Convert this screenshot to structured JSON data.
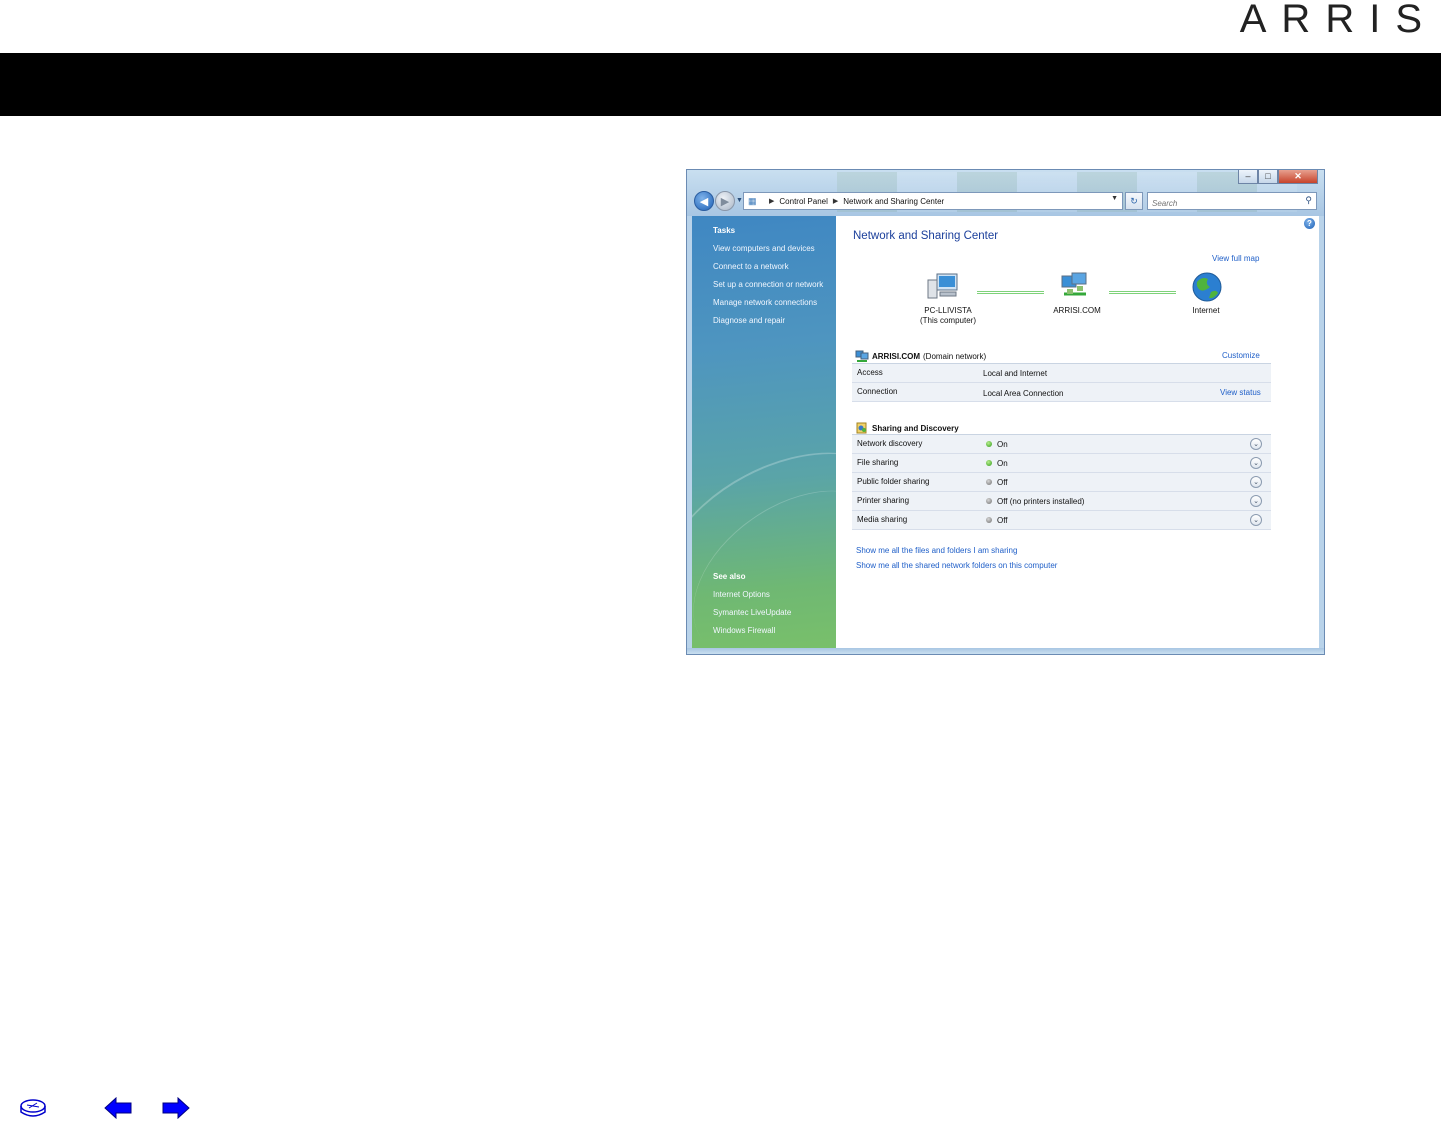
{
  "brand": {
    "logo_text": "ARRIS"
  },
  "window": {
    "address": {
      "crumb_1": "Control Panel",
      "crumb_2": "Network and Sharing Center"
    },
    "search_placeholder": "Search",
    "sidebar": {
      "tasks_heading": "Tasks",
      "tasks": [
        "View computers and devices",
        "Connect to a network",
        "Set up a connection or network",
        "Manage network connections",
        "Diagnose and repair"
      ],
      "see_also_heading": "See also",
      "see_also": [
        "Internet Options",
        "Symantec LiveUpdate",
        "Windows Firewall"
      ]
    },
    "main": {
      "title": "Network and Sharing Center",
      "view_full_map": "View full map",
      "map": {
        "computer_name": "PC-LLIVISTA",
        "computer_sub": "(This computer)",
        "network_name": "ARRISI.COM",
        "internet_name": "Internet"
      },
      "network": {
        "name": "ARRISI.COM",
        "type": "(Domain network)",
        "customize": "Customize",
        "rows": [
          {
            "key": "Access",
            "value": "Local and Internet",
            "link": ""
          },
          {
            "key": "Connection",
            "value": "Local Area Connection",
            "link": "View status"
          }
        ]
      },
      "sharing": {
        "heading": "Sharing and Discovery",
        "rows": [
          {
            "key": "Network discovery",
            "value": "On",
            "state": "on"
          },
          {
            "key": "File sharing",
            "value": "On",
            "state": "on"
          },
          {
            "key": "Public folder sharing",
            "value": "Off",
            "state": "off"
          },
          {
            "key": "Printer sharing",
            "value": "Off (no printers installed)",
            "state": "off"
          },
          {
            "key": "Media sharing",
            "value": "Off",
            "state": "off"
          }
        ]
      },
      "links": [
        "Show me all the files and folders I am sharing",
        "Show me all the shared network folders on this computer"
      ]
    }
  },
  "colors": {
    "link": "#1f5fc8",
    "title": "#1b3f9b",
    "bar": "#000000",
    "nav_arrow": "#0000ff"
  },
  "icons": {
    "home": "network-home-icon",
    "prev": "left-arrow-icon",
    "next": "right-arrow-icon"
  }
}
